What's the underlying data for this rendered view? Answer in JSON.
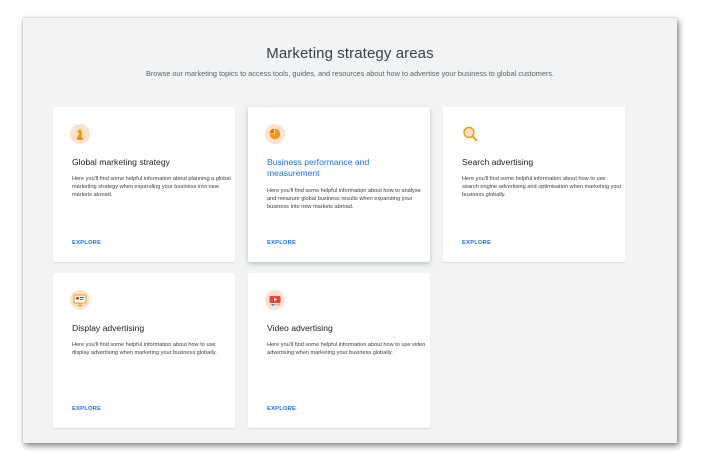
{
  "section": {
    "title": "Marketing strategy areas",
    "subtitle": "Browse our marketing topics to access tools, guides, and resources about how to advertise your business to global customers."
  },
  "cards": [
    {
      "icon": "chess-knight-icon",
      "title": "Global marketing strategy",
      "description": "Here you'll find some helpful information about planning a global marketing strategy when expanding your business into new markets abroad.",
      "cta": "EXPLORE"
    },
    {
      "icon": "pie-chart-icon",
      "title": "Business performance and measurement",
      "description": "Here you'll find some helpful information about how to analyse and measure global business results when expanding your business into new markets abroad.",
      "cta": "EXPLORE"
    },
    {
      "icon": "magnifier-icon",
      "title": "Search advertising",
      "description": "Here you'll find some helpful information about how to use search engine advertising and optimisation when marketing your business globally.",
      "cta": "EXPLORE"
    },
    {
      "icon": "display-screen-icon",
      "title": "Display advertising",
      "description": "Here you'll find some helpful information about how to use display advertising when marketing your business globally.",
      "cta": "EXPLORE"
    },
    {
      "icon": "video-player-icon",
      "title": "Video advertising",
      "description": "Here you'll find some helpful information about how to use video advertising when marketing your business globally.",
      "cta": "EXPLORE"
    }
  ],
  "colors": {
    "accent": "#1a73e8",
    "icon_orange": "#f29900",
    "icon_peach": "#fde1cf",
    "icon_red": "#ea4335",
    "background": "#f1f3f4"
  }
}
